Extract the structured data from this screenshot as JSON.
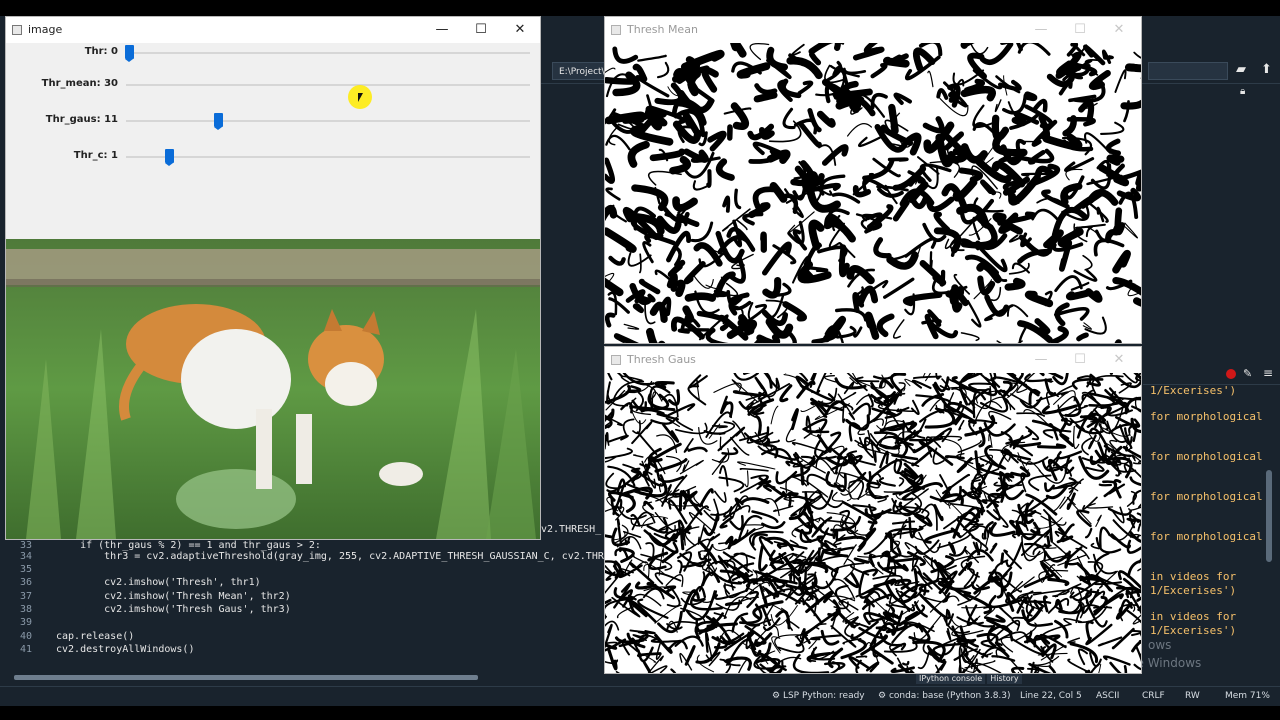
{
  "image_window": {
    "title": "image",
    "controls": {
      "minimize": "—",
      "maximize": "☐",
      "close": "✕"
    },
    "trackbars": [
      {
        "label": "Thr: 0",
        "value_fraction": 0.0
      },
      {
        "label": "Thr_mean: 30",
        "value_fraction": 0.59
      },
      {
        "label": "Thr_gaus: 11",
        "value_fraction": 0.22
      },
      {
        "label": "Thr_c: 1",
        "value_fraction": 0.1
      }
    ]
  },
  "thresh_mean_window": {
    "title": "Thresh Mean"
  },
  "thresh_gaus_window": {
    "title": "Thresh Gaus"
  },
  "ide": {
    "path": "E:\\Project\\",
    "editor": {
      "lines": [
        {
          "n": "33",
          "code": "    if (thr_gaus % 2) == 1 and thr_gaus > 2:"
        },
        {
          "n": "34",
          "code": "        thr3 = cv2.adaptiveThreshold(gray_img, 255, cv2.ADAPTIVE_THRESH_GAUSSIAN_C, cv2.THR"
        },
        {
          "n": "35",
          "code": ""
        },
        {
          "n": "36",
          "code": "    cv2.imshow('Thresh', thr1)"
        },
        {
          "n": "37",
          "code": "    cv2.imshow('Thresh Mean', thr2)"
        },
        {
          "n": "38",
          "code": "    cv2.imshow('Thresh Gaus', thr3)"
        },
        {
          "n": "39",
          "code": ""
        },
        {
          "n": "40",
          "code": "cap.release()"
        },
        {
          "n": "41",
          "code": "cv2.destroyAllWindows()"
        }
      ],
      "fragment": "v2.THRESH_"
    },
    "console_lines": [
      "1/Excerises')",
      "for morphological",
      "for morphological",
      "for morphological",
      "for morphological",
      "in videos for",
      "1/Excerises')",
      "in videos for",
      "1/Excerises')"
    ],
    "watermark": [
      "ows",
      "ivate Windows"
    ],
    "bottom_tabs": [
      "IPython console",
      "History"
    ],
    "status": {
      "lsp": "LSP Python: ready",
      "conda": "conda: base (Python 3.8.3)",
      "position": "Line 22, Col 5",
      "encoding": "ASCII",
      "eol": "CRLF",
      "rw": "RW",
      "mem": "Mem 71%"
    }
  },
  "colors": {
    "ide_bg": "#19232d",
    "accent_thumb": "#0a6cd8",
    "string": "#c9c9c9",
    "keyword": "#f5b455"
  }
}
